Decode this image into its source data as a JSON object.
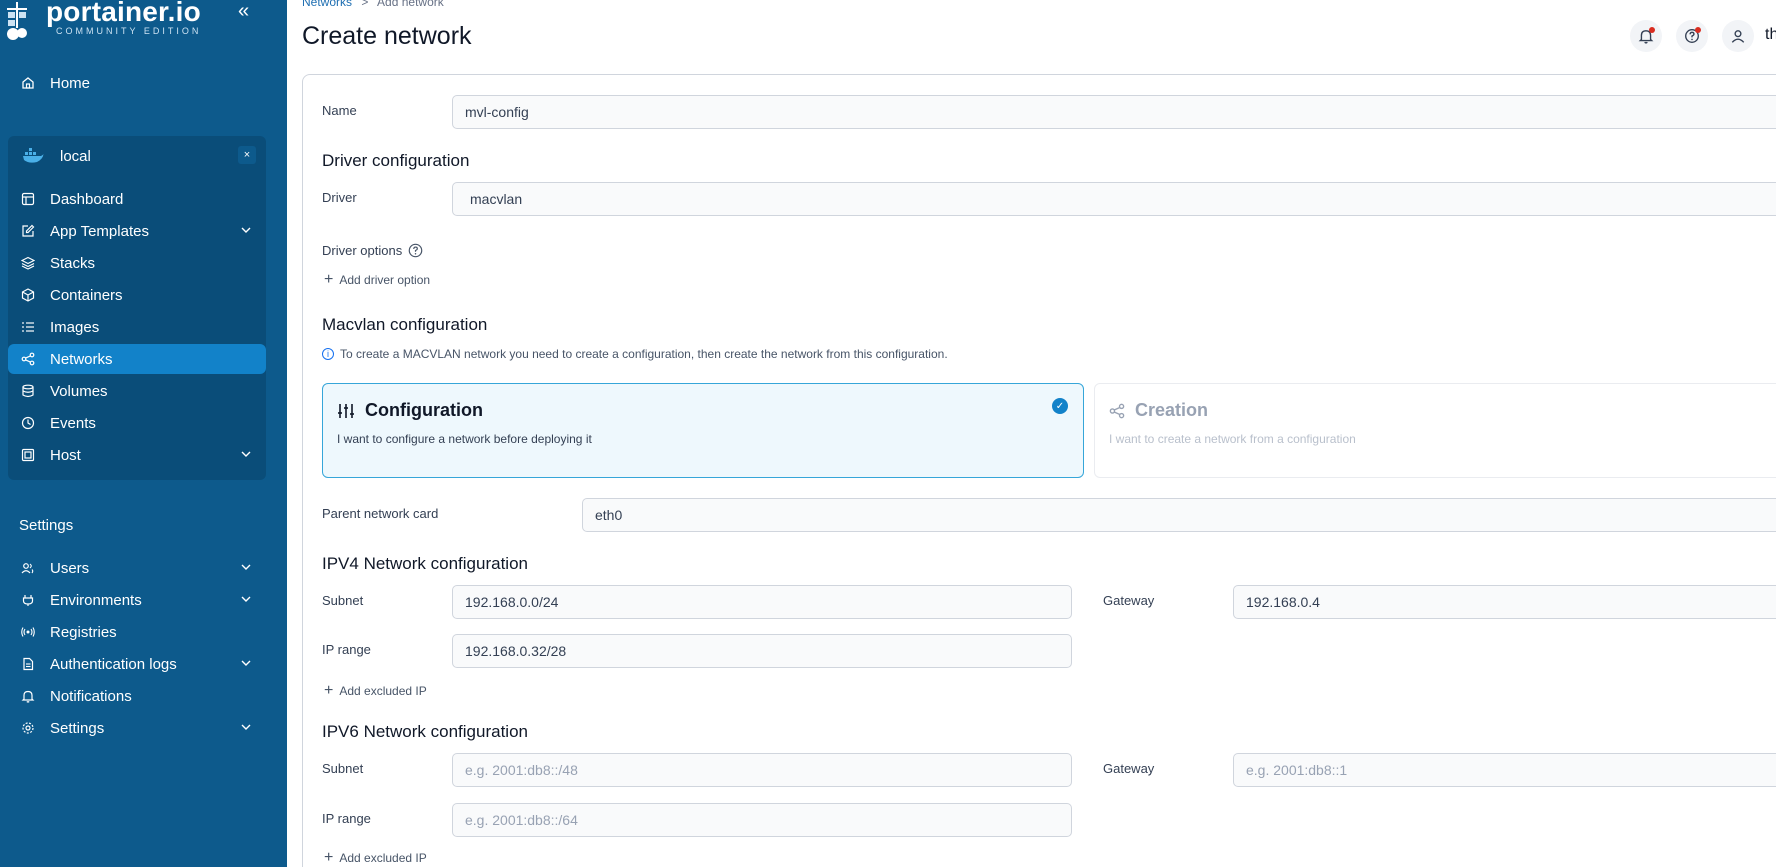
{
  "brand": {
    "name": "portainer.io",
    "edition": "COMMUNITY EDITION"
  },
  "sidebar": {
    "home": "Home",
    "environment": {
      "name": "local",
      "close": "×"
    },
    "env_items": [
      {
        "label": "Dashboard"
      },
      {
        "label": "App Templates"
      },
      {
        "label": "Stacks"
      },
      {
        "label": "Containers"
      },
      {
        "label": "Images"
      },
      {
        "label": "Networks"
      },
      {
        "label": "Volumes"
      },
      {
        "label": "Events"
      },
      {
        "label": "Host"
      }
    ],
    "settings_heading": "Settings",
    "settings_items": [
      {
        "label": "Users"
      },
      {
        "label": "Environments"
      },
      {
        "label": "Registries"
      },
      {
        "label": "Authentication logs"
      },
      {
        "label": "Notifications"
      },
      {
        "label": "Settings"
      }
    ]
  },
  "breadcrumb": {
    "parent": "Networks",
    "sep": ">",
    "current": "Add network"
  },
  "page_title": "Create network",
  "header": {
    "user_initial": "th"
  },
  "form": {
    "name_label": "Name",
    "name_value": "mvl-config",
    "driver_config_heading": "Driver configuration",
    "driver_label": "Driver",
    "driver_value": "macvlan",
    "driver_options_label": "Driver options",
    "add_driver_option": "Add driver option",
    "macvlan_heading": "Macvlan configuration",
    "macvlan_info": "To create a MACVLAN network you need to create a configuration, then create the network from this configuration.",
    "config_title": "Configuration",
    "config_desc": "I want to configure a network before deploying it",
    "creation_title": "Creation",
    "creation_desc": "I want to create a network from a configuration",
    "parent_card_label": "Parent network card",
    "parent_card_value": "eth0",
    "ipv4_heading": "IPV4 Network configuration",
    "ipv4_subnet_label": "Subnet",
    "ipv4_subnet_value": "192.168.0.0/24",
    "ipv4_gateway_label": "Gateway",
    "ipv4_gateway_value": "192.168.0.4",
    "ipv4_range_label": "IP range",
    "ipv4_range_value": "192.168.0.32/28",
    "add_excluded_ip": "Add excluded IP",
    "ipv6_heading": "IPV6 Network configuration",
    "ipv6_subnet_label": "Subnet",
    "ipv6_subnet_placeholder": "e.g. 2001:db8::/48",
    "ipv6_gateway_label": "Gateway",
    "ipv6_gateway_placeholder": "e.g. 2001:db8::1",
    "ipv6_range_label": "IP range",
    "ipv6_range_placeholder": "e.g. 2001:db8::/64",
    "add_excluded_ip_v6": "Add excluded IP"
  },
  "colors": {
    "sidebar": "#0d5a8c",
    "active": "#1282c9",
    "accent": "#36a6d9"
  }
}
